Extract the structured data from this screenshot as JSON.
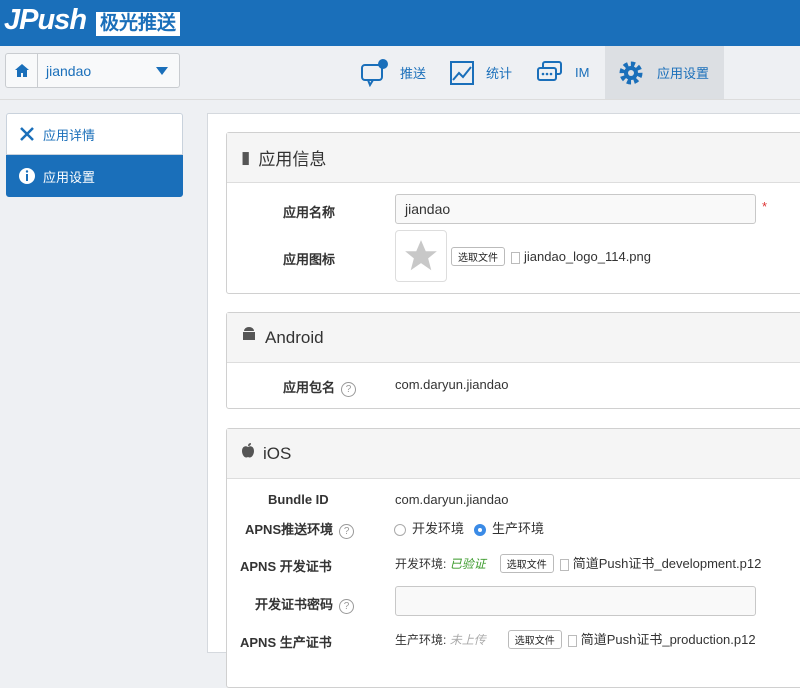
{
  "header": {
    "logo": "JPush",
    "logo_cn": "极光推送"
  },
  "app_select": {
    "value": "jiandao"
  },
  "nav": [
    {
      "label": "推送"
    },
    {
      "label": "统计"
    },
    {
      "label": "IM"
    },
    {
      "label": "应用设置"
    }
  ],
  "sidebar": [
    {
      "label": "应用详情"
    },
    {
      "label": "应用设置"
    }
  ],
  "app_info": {
    "title": "应用信息",
    "name_label": "应用名称",
    "name_value": "jiandao",
    "required": "*",
    "icon_label": "应用图标",
    "choose_file": "选取文件",
    "icon_file": "jiandao_logo_114.png"
  },
  "android": {
    "title": "Android",
    "pkg_label": "应用包名",
    "pkg_value": "com.daryun.jiandao",
    "help": "?"
  },
  "ios": {
    "title": "iOS",
    "bundle_label": "Bundle ID",
    "bundle_value": "com.daryun.jiandao",
    "apns_env_label": "APNS推送环境",
    "env_dev": "开发环境",
    "env_prod": "生产环境",
    "dev_cert_label": "APNS 开发证书",
    "dev_status_prefix": "开发环境:",
    "dev_status": "已验证",
    "dev_file": "简道Push证书_development.p12",
    "dev_pwd_label": "开发证书密码",
    "dev_pwd_value": "",
    "prod_cert_label": "APNS 生产证书",
    "prod_status_prefix": "生产环境:",
    "prod_status": "未上传",
    "prod_file": "简道Push证书_production.p12",
    "choose_file": "选取文件",
    "help": "?"
  },
  "colors": {
    "brand": "#1a6fba",
    "verified": "#3a9a2a"
  }
}
